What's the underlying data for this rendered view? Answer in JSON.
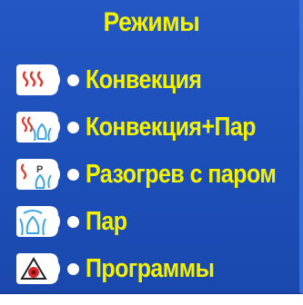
{
  "title": "Режимы",
  "modes": [
    {
      "label": "Конвекция",
      "icon": "convection-icon"
    },
    {
      "label": "Конвекция+Пар",
      "icon": "convection-steam-icon"
    },
    {
      "label": "Разогрев с паром",
      "icon": "preheat-steam-icon"
    },
    {
      "label": "Пар",
      "icon": "steam-icon"
    },
    {
      "label": "Программы",
      "icon": "programs-icon"
    }
  ],
  "colors": {
    "background": "#1d4fb9",
    "text": "#f4f200",
    "convection": "#e23a2e",
    "steam": "#3aa6e8"
  }
}
